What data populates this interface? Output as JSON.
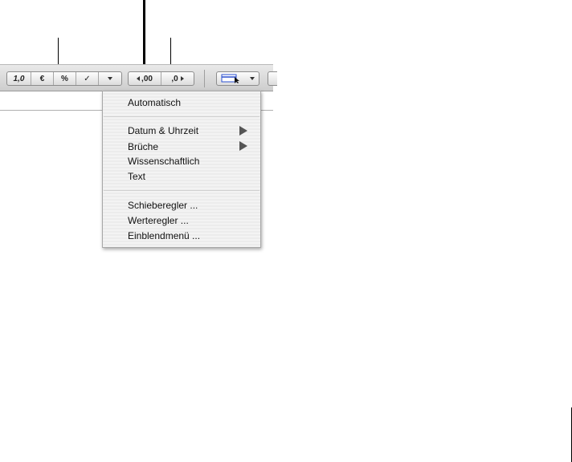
{
  "toolbar": {
    "format_buttons": {
      "number": "1,0",
      "currency": "€",
      "percent": "%",
      "checkbox": "✓"
    },
    "decimal_buttons": {
      "increase": ",00",
      "decrease": ",0"
    }
  },
  "menu": {
    "items": [
      {
        "label": "Automatisch"
      },
      {
        "label": "Datum & Uhrzeit",
        "submenu": true
      },
      {
        "label": "Brüche",
        "submenu": true
      },
      {
        "label": "Wissenschaftlich"
      },
      {
        "label": "Text"
      },
      {
        "label": "Schieberegler ..."
      },
      {
        "label": "Werteregler ..."
      },
      {
        "label": "Einblendmenü ..."
      }
    ]
  },
  "icons": [
    "chevron-down-icon",
    "triangle-left-icon",
    "triangle-right-icon",
    "table-select-icon",
    "submenu-arrow-icon"
  ]
}
